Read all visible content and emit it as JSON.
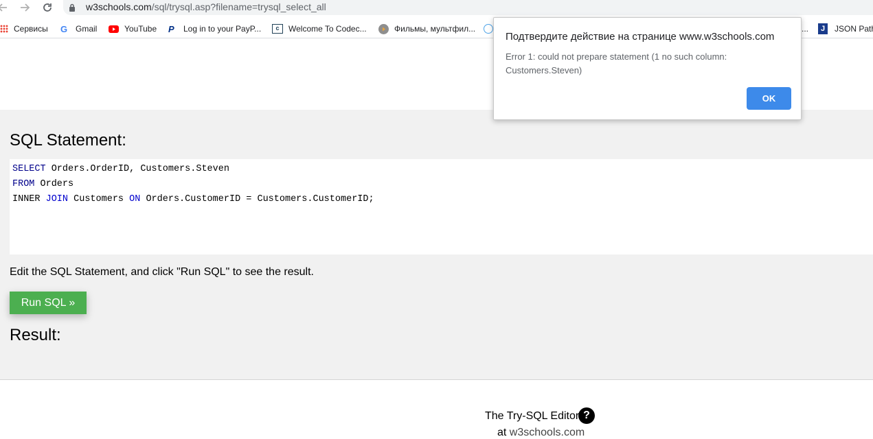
{
  "browser": {
    "url_host": "w3schools.com",
    "url_path": "/sql/trysql.asp?filename=trysql_select_all",
    "bookmarks": [
      {
        "label": "Сервисы",
        "icon": "apps-grid-icon",
        "color": "#ea4335"
      },
      {
        "label": "Gmail",
        "icon": "google-icon",
        "color": "#4285f4"
      },
      {
        "label": "YouTube",
        "icon": "youtube-icon",
        "color": "#ff0000"
      },
      {
        "label": "Log in to your PayP...",
        "icon": "paypal-icon",
        "color": "#003087"
      },
      {
        "label": "Welcome To Codec...",
        "icon": "codecademy-icon",
        "color": "#1f4056"
      },
      {
        "label": "Фильмы, мультфил...",
        "icon": "film-icon",
        "color": "#8a6d3b"
      },
      {
        "label": "...",
        "icon": "bookmark-icon",
        "color": "#4285f4"
      },
      {
        "label": "JSON Path",
        "icon": "json-path-icon",
        "color": "#1a3c8c"
      }
    ]
  },
  "page": {
    "sql_title": "SQL Statement:",
    "sql_lines": [
      {
        "kw1": "SELECT",
        "rest1": " Orders.OrderID, Customers.Steven"
      },
      {
        "kw1": "FROM",
        "rest1": " Orders"
      },
      {
        "pre": "INNER ",
        "kw1": "JOIN",
        "mid": " Customers ",
        "kw2": "ON",
        "rest2": " Orders.CustomerID = Customers.CustomerID;"
      }
    ],
    "hint": "Edit the SQL Statement, and click \"Run SQL\" to see the result.",
    "run_label": "Run SQL »",
    "result_title": "Result:",
    "footer_line1": "The Try-SQL Editor",
    "help_label": "?",
    "footer_at": "at ",
    "footer_link": "w3schools.com"
  },
  "dialog": {
    "title": "Подтвердите действие на странице www.w3schools.com",
    "message": "Error 1: could not prepare statement (1 no such column: Customers.Steven)",
    "ok_label": "OK"
  }
}
